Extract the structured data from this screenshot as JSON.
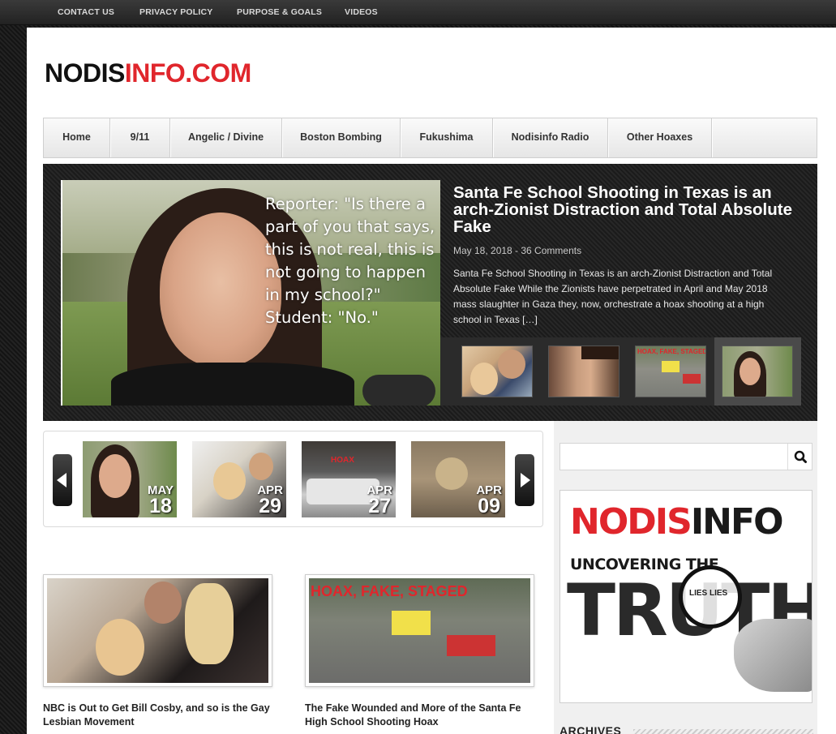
{
  "topbar": {
    "links": [
      "CONTACT US",
      "PRIVACY POLICY",
      "PURPOSE & GOALS",
      "VIDEOS"
    ]
  },
  "logo": {
    "part1": "NODIS",
    "part2": "INFO.COM"
  },
  "nav": [
    "Home",
    "9/11",
    "Angelic / Divine",
    "Boston Bombing",
    "Fukushima",
    "Nodisinfo Radio",
    "Other Hoaxes"
  ],
  "featured": {
    "image_quote": "Reporter: \"Is there a part of you that says, this is not real, this is not going to happen in my school?\" Student: \"No.\"",
    "title": "Santa Fe School Shooting in Texas is an arch-Zionist Distraction and Total Absolute Fake",
    "meta": "May 18, 2018 - 36 Comments",
    "excerpt": "Santa Fe School Shooting in Texas is an arch-Zionist Distraction and Total Absolute Fake While the Zionists have perpetrated in April and May 2018 mass slaughter in Gaza they, now, orchestrate a hoax shooting at a high school in Texas […]",
    "thumb_overlay_text": "HOAX, FAKE, STAGED"
  },
  "carousel": {
    "items": [
      {
        "month": "MAY",
        "day": "18"
      },
      {
        "month": "APR",
        "day": "29"
      },
      {
        "month": "APR",
        "day": "27",
        "overlay": "HOAX"
      },
      {
        "month": "APR",
        "day": "09"
      }
    ]
  },
  "articles": [
    {
      "title": "NBC is Out to Get Bill Cosby, and so is the Gay Lesbian Movement"
    },
    {
      "title": "The Fake Wounded and More of the Santa Fe High School Shooting Hoax",
      "image_overlay": "HOAX, FAKE, STAGED"
    }
  ],
  "sidebar": {
    "search_placeholder": "",
    "banner": {
      "line1a": "NODIS",
      "line1b": "INFO",
      "line2": "UNCOVERING THE",
      "line3": "TRUTH",
      "lies": "LIES LIES"
    },
    "archives_heading": "ARCHIVES"
  },
  "colors": {
    "brand_red": "#e0262c",
    "dark": "#111111"
  }
}
